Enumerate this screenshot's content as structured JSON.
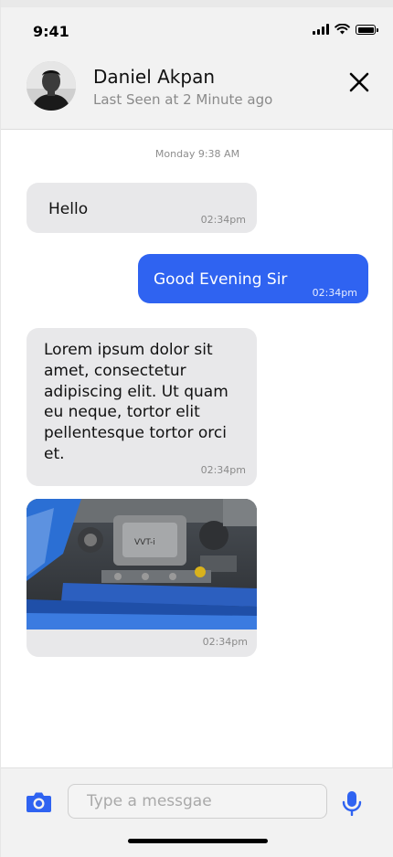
{
  "status_bar": {
    "time": "9:41"
  },
  "header": {
    "contact_name": "Daniel Akpan",
    "last_seen": "Last Seen at 2 Minute ago",
    "close_icon": "close-icon"
  },
  "chat": {
    "date_divider": "Monday 9:38 AM",
    "messages": [
      {
        "direction": "incoming",
        "type": "text",
        "text": "Hello",
        "time": "02:34pm"
      },
      {
        "direction": "outgoing",
        "type": "text",
        "text": "Good Evening Sir",
        "time": "02:34pm"
      },
      {
        "direction": "incoming",
        "type": "text",
        "text": "Lorem ipsum dolor sit amet, consectetur adipiscing elit. Ut quam eu neque, tortor elit pellentesque tortor orci et.",
        "time": "02:34pm"
      },
      {
        "direction": "incoming",
        "type": "image",
        "image": "car-engine-photo",
        "time": "02:34pm"
      }
    ]
  },
  "composer": {
    "placeholder": "Type a messgae",
    "value": "",
    "camera_icon": "camera-icon",
    "mic_icon": "microphone-icon"
  },
  "colors": {
    "accent": "#2F63F1",
    "incoming_bubble": "#E8E8EA",
    "header_bg": "#F2F2F2"
  }
}
